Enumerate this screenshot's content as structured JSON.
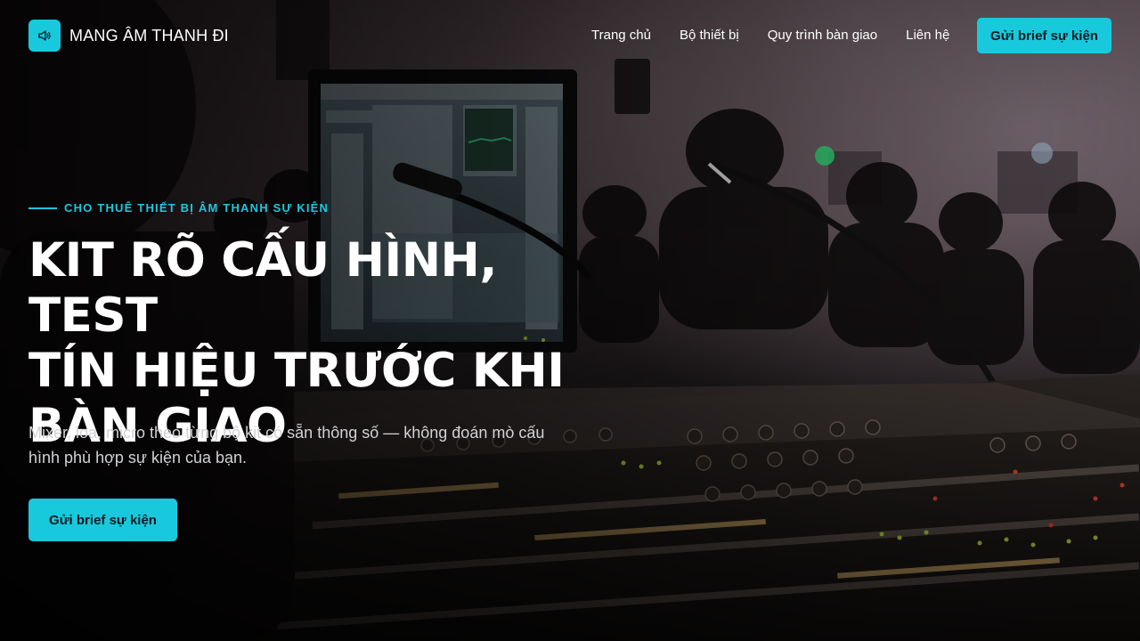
{
  "brand": {
    "name": "MANG ÂM THANH ĐI",
    "logo_icon": "speaker-icon",
    "accent_color": "#18c9de"
  },
  "nav": {
    "links": [
      {
        "label": "Trang chủ"
      },
      {
        "label": "Bộ thiết bị"
      },
      {
        "label": "Quy trình bàn giao"
      },
      {
        "label": "Liên hệ"
      }
    ],
    "cta_label": "Gửi brief sự kiện"
  },
  "hero": {
    "eyebrow": "CHO THUÊ THIẾT BỊ ÂM THANH SỰ KIỆN",
    "headline_lines": [
      "KIT RÕ CẤU HÌNH, TEST",
      "TÍN HIỆU TRƯỚC KHI",
      "BÀN GIAO"
    ],
    "subtitle": "Mixer, loa, micro theo từng bộ kit có sẵn thông số — không đoán mò cấu hình phù hợp sự kiện của bạn.",
    "cta_label": "Gửi brief sự kiện",
    "background": "audio-mixing-console-photo"
  }
}
